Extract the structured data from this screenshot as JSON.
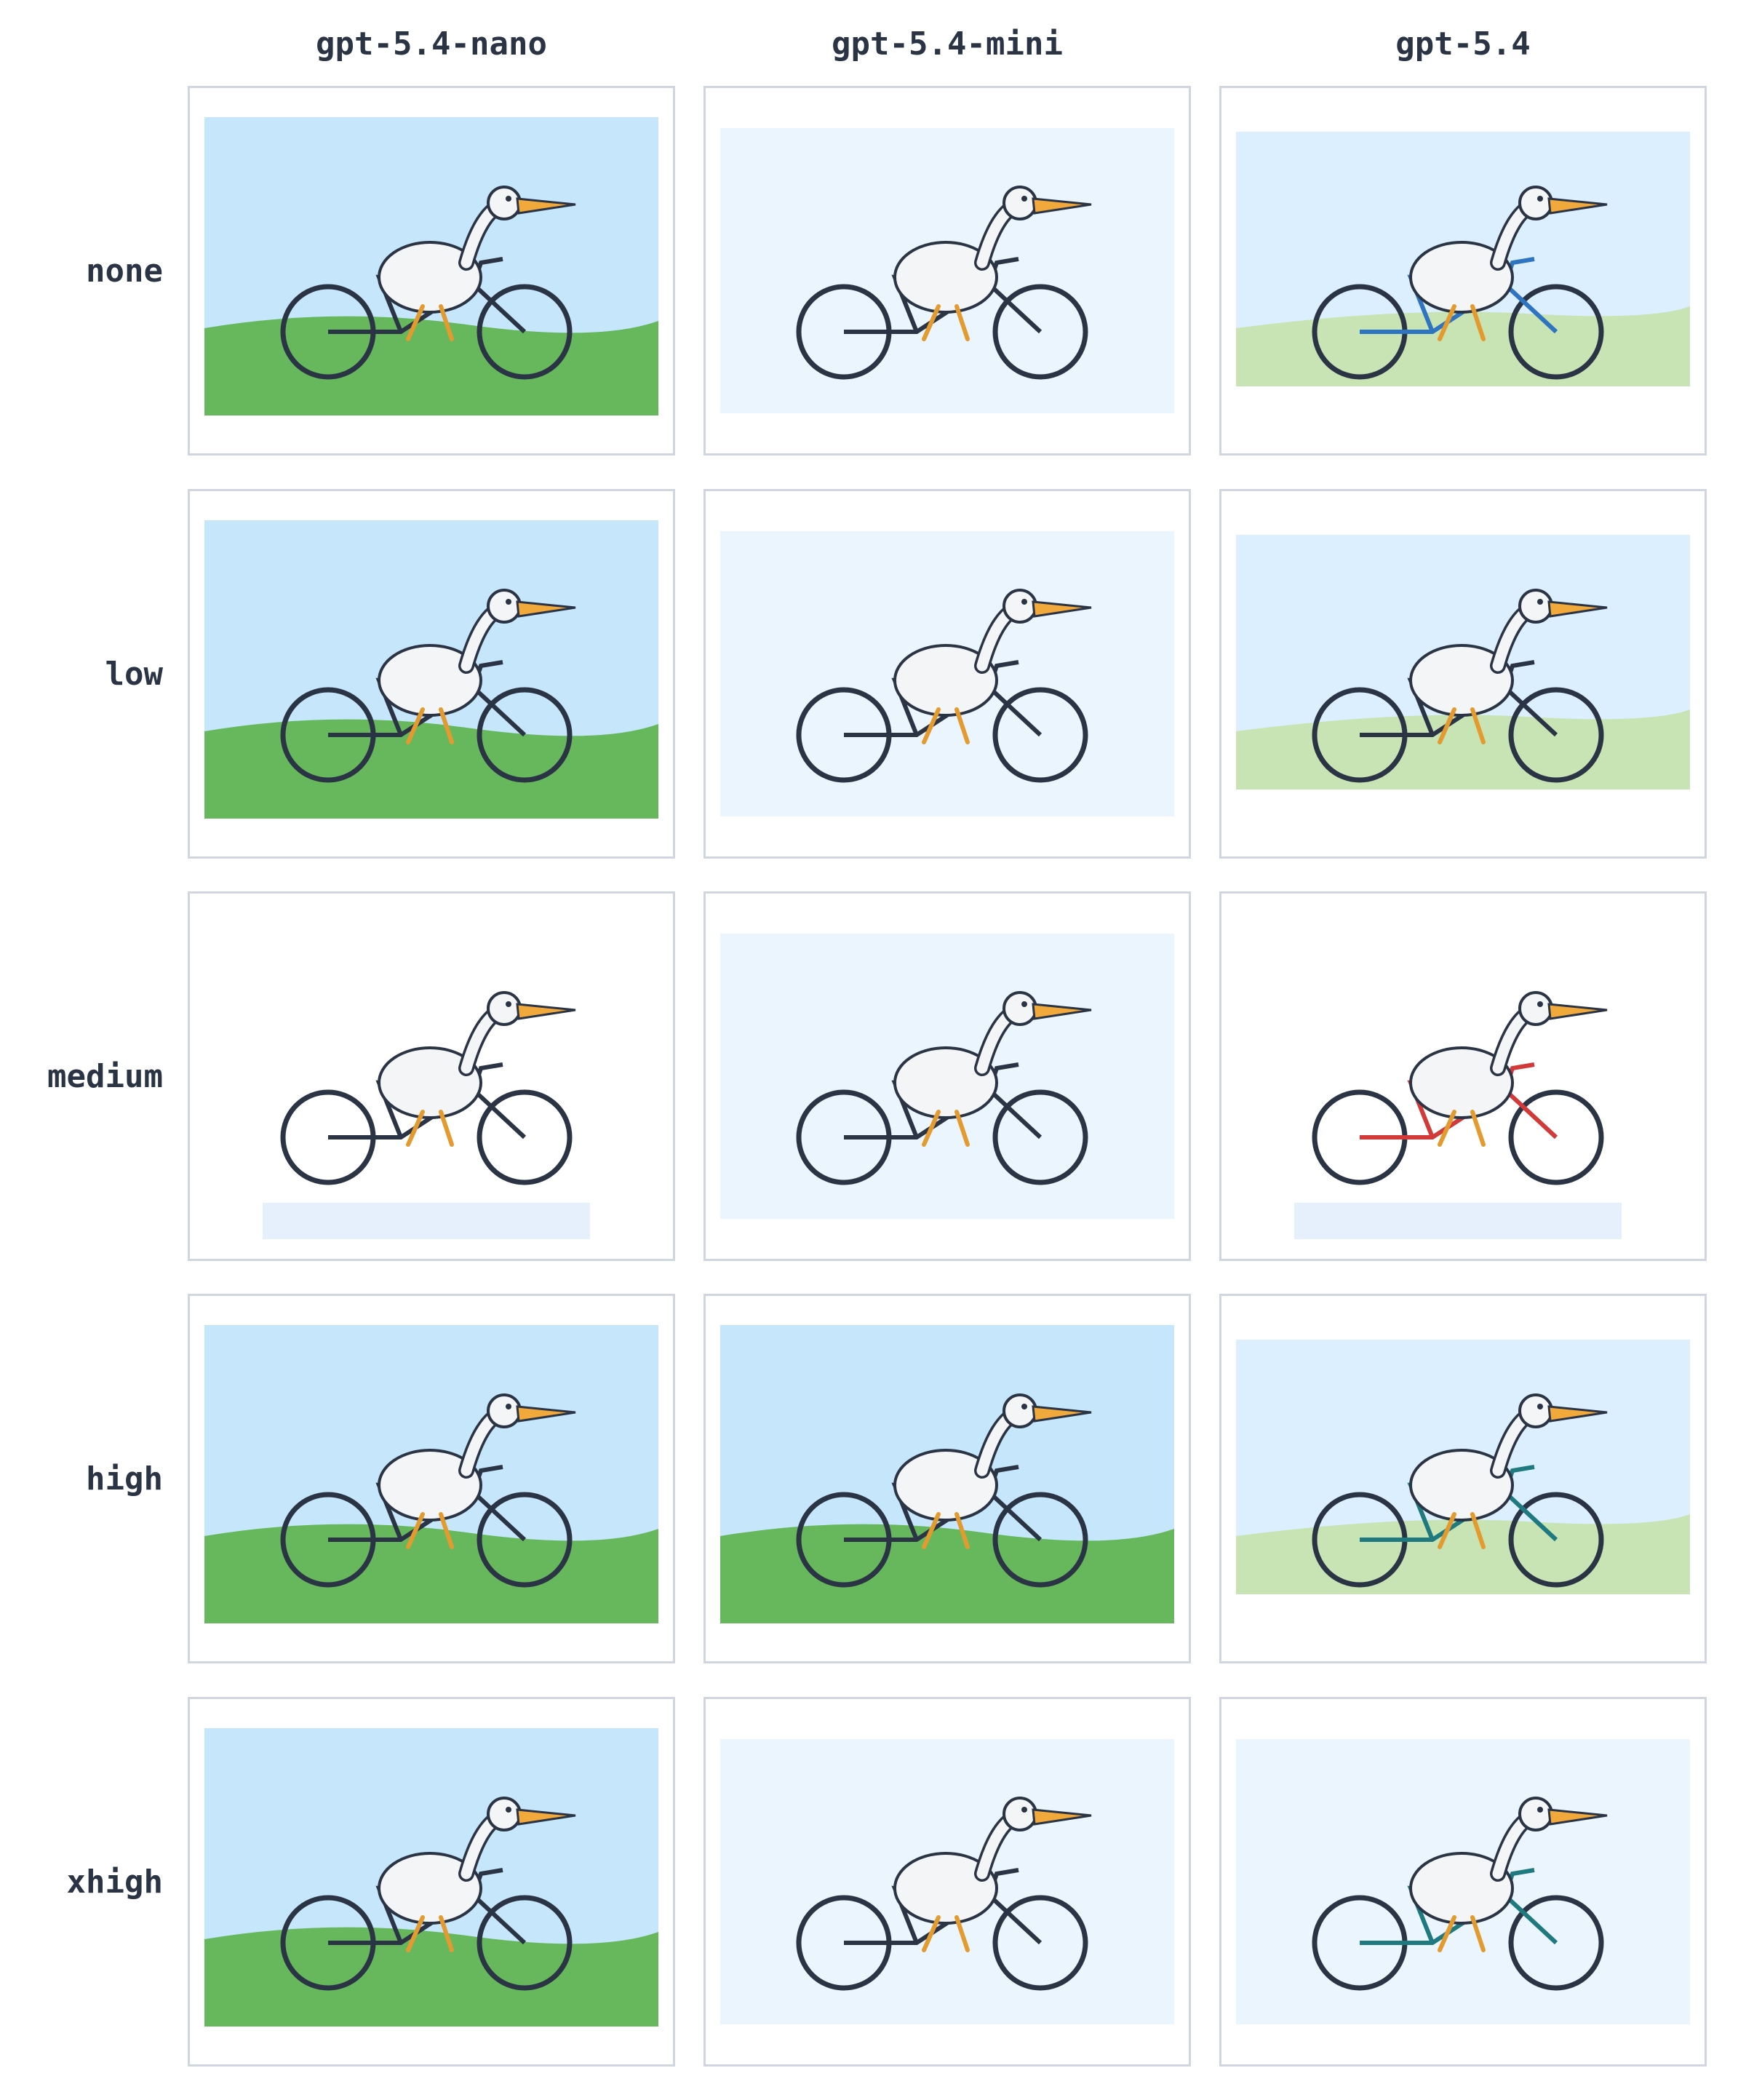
{
  "columns": [
    "gpt-5.4-nano",
    "gpt-5.4-mini",
    "gpt-5.4"
  ],
  "rows": [
    "none",
    "low",
    "medium",
    "high",
    "xhigh"
  ],
  "cells": [
    [
      {
        "scene": "sky-grass",
        "bike": "dark"
      },
      {
        "scene": "pale-sky",
        "bike": "dark"
      },
      {
        "scene": "sky-pale-grass",
        "bike": "blue"
      }
    ],
    [
      {
        "scene": "sky-grass",
        "bike": "dark"
      },
      {
        "scene": "pale",
        "bike": "dark"
      },
      {
        "scene": "sky-pale-grass",
        "bike": "dark"
      }
    ],
    [
      {
        "scene": "white",
        "bike": "dark"
      },
      {
        "scene": "pale",
        "bike": "dark"
      },
      {
        "scene": "white",
        "bike": "red"
      }
    ],
    [
      {
        "scene": "sky-grass",
        "bike": "dark"
      },
      {
        "scene": "sky-grass",
        "bike": "dark"
      },
      {
        "scene": "sky-pale-grass",
        "bike": "teal"
      }
    ],
    [
      {
        "scene": "sky-grass",
        "bike": "dark"
      },
      {
        "scene": "pale",
        "bike": "dark"
      },
      {
        "scene": "pale",
        "bike": "teal"
      }
    ]
  ],
  "colors": {
    "border": "#cfd6e0",
    "label": "#2b3445",
    "sky": "#c6e6fb",
    "grass": "#67b85c",
    "pale_grass": "#c9e4b4",
    "beak": "#f2a93b"
  }
}
